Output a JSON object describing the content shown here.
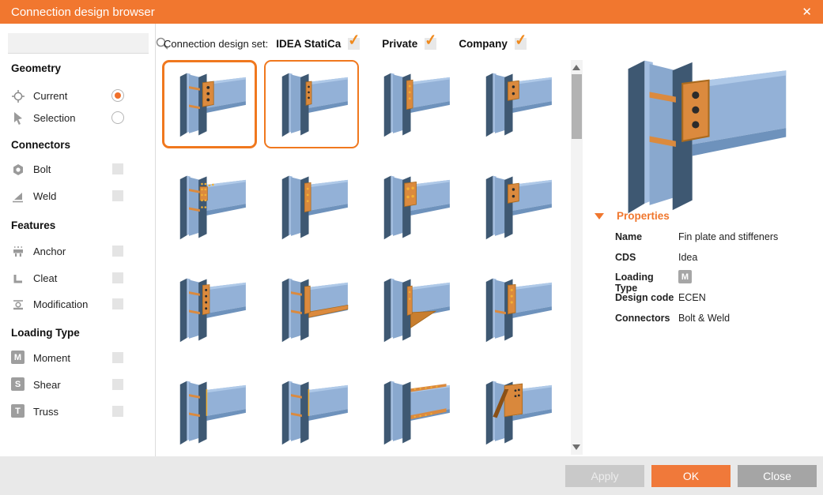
{
  "window": {
    "title": "Connection design browser",
    "close_icon": "✕"
  },
  "search": {
    "placeholder": ""
  },
  "sidebar": {
    "sections": [
      {
        "label": "Geometry",
        "items": [
          {
            "label": "Current",
            "icon": "crosshair-target-icon",
            "control": "radio",
            "checked": true
          },
          {
            "label": "Selection",
            "icon": "cursor-arrow-icon",
            "control": "radio",
            "checked": false
          }
        ]
      },
      {
        "label": "Connectors",
        "items": [
          {
            "label": "Bolt",
            "icon": "bolt-nut-icon",
            "control": "checkbox",
            "checked": false
          },
          {
            "label": "Weld",
            "icon": "weld-fillet-icon",
            "control": "checkbox",
            "checked": false
          }
        ]
      },
      {
        "label": "Features",
        "items": [
          {
            "label": "Anchor",
            "icon": "anchor-baseplate-icon",
            "control": "checkbox",
            "checked": false
          },
          {
            "label": "Cleat",
            "icon": "cleat-angle-icon",
            "control": "checkbox",
            "checked": false
          },
          {
            "label": "Modification",
            "icon": "modification-plate-icon",
            "control": "checkbox",
            "checked": false
          }
        ]
      },
      {
        "label": "Loading Type",
        "items": [
          {
            "label": "Moment",
            "badge": "M",
            "control": "checkbox",
            "checked": false
          },
          {
            "label": "Shear",
            "badge": "S",
            "control": "checkbox",
            "checked": false
          },
          {
            "label": "Truss",
            "badge": "T",
            "control": "checkbox",
            "checked": false
          }
        ]
      }
    ]
  },
  "design_set": {
    "label": "Connection design set:",
    "options": [
      {
        "label": "IDEA StatiCa",
        "checked": true
      },
      {
        "label": "Private",
        "checked": true
      },
      {
        "label": "Company",
        "checked": true
      }
    ]
  },
  "grid": {
    "thumbnails": [
      {
        "variant": "fin-plate-stiffeners",
        "state": "selected"
      },
      {
        "variant": "fin-plate",
        "state": "highlighted"
      },
      {
        "variant": "end-plate",
        "state": "none"
      },
      {
        "variant": "plate-2-bolts",
        "state": "none"
      },
      {
        "variant": "bolted-splice",
        "state": "none"
      },
      {
        "variant": "end-plate",
        "state": "none"
      },
      {
        "variant": "end-plate-wide",
        "state": "none"
      },
      {
        "variant": "plate-2-bolts",
        "state": "none"
      },
      {
        "variant": "end-plate-4-bolts",
        "state": "none"
      },
      {
        "variant": "haunch-plate",
        "state": "none"
      },
      {
        "variant": "haunch-triangle",
        "state": "none"
      },
      {
        "variant": "end-plate-stiffener",
        "state": "none"
      },
      {
        "variant": "welded",
        "state": "none"
      },
      {
        "variant": "welded",
        "state": "none"
      },
      {
        "variant": "splice-long",
        "state": "none"
      },
      {
        "variant": "bracket-diagonal",
        "state": "none"
      }
    ]
  },
  "properties": {
    "header": "Properties",
    "rows": [
      {
        "label": "Name",
        "value": "Fin plate and stiffeners"
      },
      {
        "label": "CDS",
        "value": "Idea"
      },
      {
        "label": "Loading Type",
        "value": "M",
        "is_badge": true
      },
      {
        "label": "Design code",
        "value": "ECEN"
      },
      {
        "label": "Connectors",
        "value": "Bolt & Weld"
      }
    ]
  },
  "footer": {
    "buttons": [
      {
        "label": "Apply",
        "state": "disabled"
      },
      {
        "label": "OK",
        "state": "primary"
      },
      {
        "label": "Close",
        "state": "default"
      }
    ]
  },
  "colors": {
    "accent_orange": "#F0772E",
    "check_orange": "#F08A1E",
    "selection_border": "#F0781E",
    "beam_blue": "#93B1D7",
    "column_dark": "#3E5872",
    "plate_orange": "#DB8A3E",
    "badge_gray": "#A0A0A0"
  }
}
